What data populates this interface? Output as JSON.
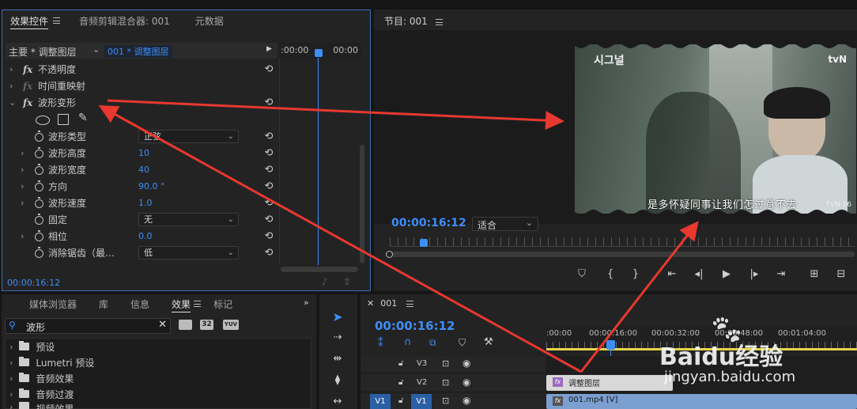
{
  "effect_controls": {
    "tabs": [
      {
        "label": "效果控件"
      },
      {
        "label": "音频剪辑混合器: 001"
      },
      {
        "label": "元数据"
      }
    ],
    "source_dropdown": "主要 * 调整图层",
    "clip_label": "001 * 调整图层",
    "ruler_left": ":00:00",
    "ruler_right": "00:00",
    "properties": [
      {
        "name": "不透明度",
        "kind": "fx-collapsed"
      },
      {
        "name": "时间重映射",
        "kind": "fx-off"
      },
      {
        "name": "波形变形",
        "kind": "fx-expanded"
      },
      {
        "name": "波形类型",
        "value": "正弦",
        "kind": "dropdown"
      },
      {
        "name": "波形高度",
        "value": "10",
        "kind": "number"
      },
      {
        "name": "波形宽度",
        "value": "40",
        "kind": "number"
      },
      {
        "name": "方向",
        "value": "90.0 °",
        "kind": "number"
      },
      {
        "name": "波形速度",
        "value": "1.0",
        "kind": "number"
      },
      {
        "name": "固定",
        "value": "无",
        "kind": "dropdown"
      },
      {
        "name": "相位",
        "value": "0.0",
        "kind": "number"
      },
      {
        "name": "消除锯齿（最…",
        "value": "低",
        "kind": "dropdown"
      }
    ],
    "timecode": "00:00:16:12"
  },
  "program_monitor": {
    "title": "节目: 001",
    "timecode": "00:00:16:12",
    "fit_label": "适合",
    "video": {
      "logo_left": "시그널",
      "logo_right": "tvN",
      "subtitle": "是多怀疑同事让我们怎过意不去",
      "watermark": "TVN 16"
    }
  },
  "project_panel": {
    "tabs": [
      {
        "label": "媒体浏览器"
      },
      {
        "label": "库"
      },
      {
        "label": "信息"
      },
      {
        "label": "效果"
      },
      {
        "label": "标记"
      }
    ],
    "search_value": "波形",
    "badges": [
      "32",
      "YUV"
    ],
    "items": [
      {
        "label": "预设"
      },
      {
        "label": "Lumetri 预设"
      },
      {
        "label": "音频效果"
      },
      {
        "label": "音频过渡"
      },
      {
        "label": "视频效果"
      }
    ]
  },
  "timeline": {
    "sequence": "001",
    "timecode": "00:00:16:12",
    "ruler": [
      ":00:00",
      "00:00:16:00",
      "00:00:32:00",
      "00:00:48:00",
      "00:01:04:00"
    ],
    "tracks": [
      {
        "name": "V3"
      },
      {
        "name": "V2"
      },
      {
        "name": "V1"
      }
    ],
    "v1_source": "V1",
    "clips": [
      {
        "label": "调整图层"
      },
      {
        "label": "001.mp4 [V]"
      }
    ]
  },
  "watermark": {
    "brand": "Baidu经验",
    "url": "jingyan.baidu.com"
  },
  "colors": {
    "accent": "#3e8ef7",
    "arrow": "#e8382f"
  }
}
